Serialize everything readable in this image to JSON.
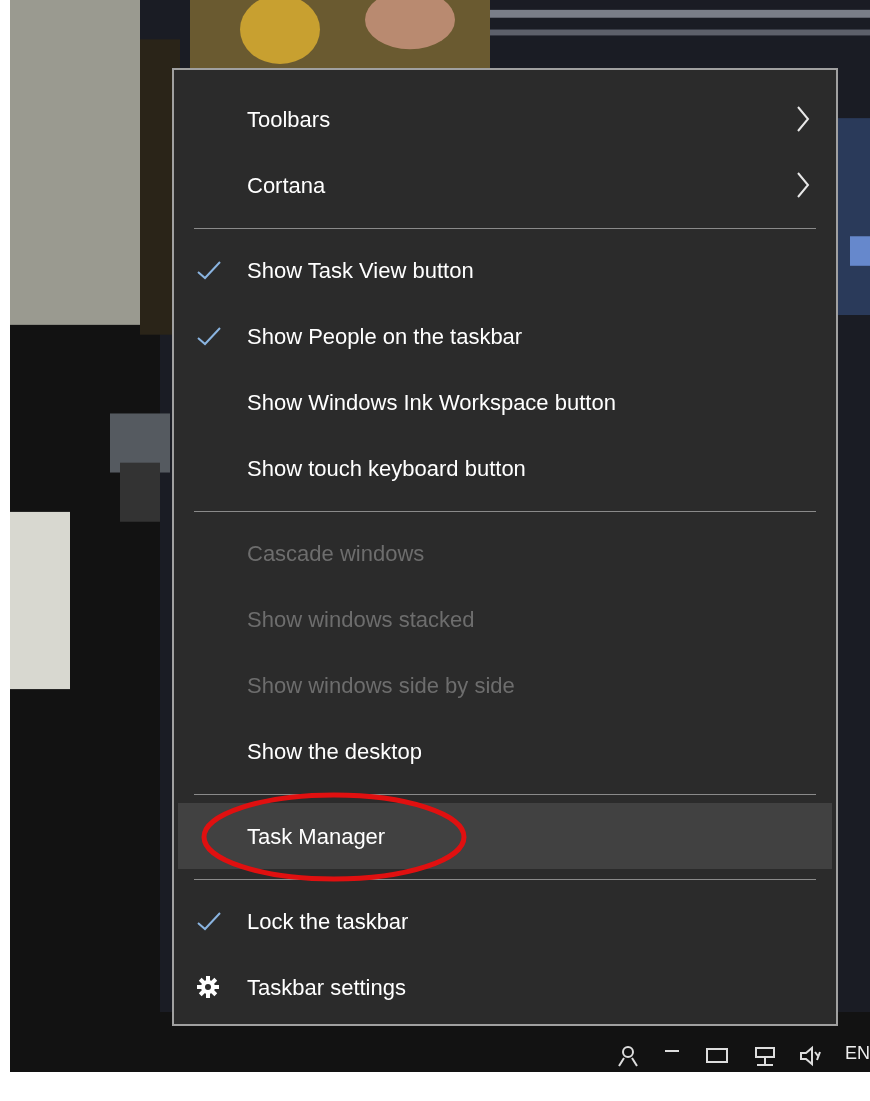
{
  "menu": {
    "groups": [
      [
        {
          "label": "Toolbars",
          "kind": "submenu",
          "checked": false,
          "disabled": false,
          "selected": false,
          "circled": false
        },
        {
          "label": "Cortana",
          "kind": "submenu",
          "checked": false,
          "disabled": false,
          "selected": false,
          "circled": false
        }
      ],
      [
        {
          "label": "Show Task View button",
          "kind": "command",
          "checked": true,
          "disabled": false,
          "selected": false,
          "circled": false
        },
        {
          "label": "Show People on the taskbar",
          "kind": "command",
          "checked": true,
          "disabled": false,
          "selected": false,
          "circled": false
        },
        {
          "label": "Show Windows Ink Workspace button",
          "kind": "command",
          "checked": false,
          "disabled": false,
          "selected": false,
          "circled": false
        },
        {
          "label": "Show touch keyboard button",
          "kind": "command",
          "checked": false,
          "disabled": false,
          "selected": false,
          "circled": false
        }
      ],
      [
        {
          "label": "Cascade windows",
          "kind": "command",
          "checked": false,
          "disabled": true,
          "selected": false,
          "circled": false
        },
        {
          "label": "Show windows stacked",
          "kind": "command",
          "checked": false,
          "disabled": true,
          "selected": false,
          "circled": false
        },
        {
          "label": "Show windows side by side",
          "kind": "command",
          "checked": false,
          "disabled": true,
          "selected": false,
          "circled": false
        },
        {
          "label": "Show the desktop",
          "kind": "command",
          "checked": false,
          "disabled": false,
          "selected": false,
          "circled": false
        }
      ],
      [
        {
          "label": "Task Manager",
          "kind": "command",
          "checked": false,
          "disabled": false,
          "selected": true,
          "circled": true
        }
      ],
      [
        {
          "label": "Lock the taskbar",
          "kind": "command",
          "checked": true,
          "disabled": false,
          "selected": false,
          "circled": false
        },
        {
          "label": "Taskbar settings",
          "kind": "settings",
          "checked": false,
          "disabled": false,
          "selected": false,
          "circled": false
        }
      ]
    ]
  },
  "taskbar": {
    "language": "EN"
  }
}
